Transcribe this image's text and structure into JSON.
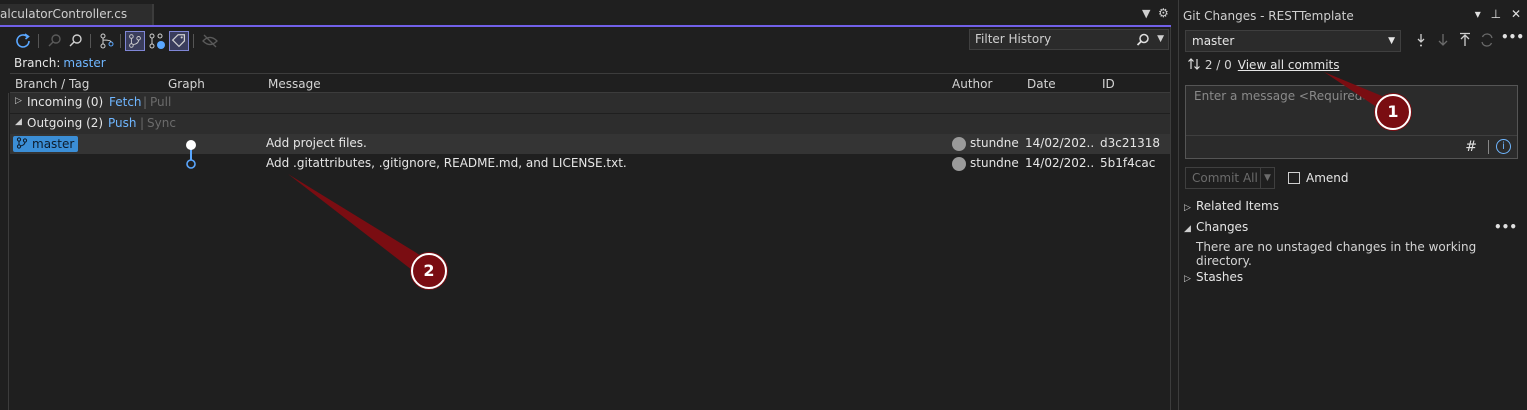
{
  "history": {
    "tab_label": "alculatorController.cs",
    "branch_label": "Branch:",
    "branch_value": "master",
    "filter_placeholder": "Filter History",
    "columns": [
      "Branch / Tag",
      "Graph",
      "Message",
      "Author",
      "Date",
      "ID"
    ],
    "incoming": {
      "label": "Incoming (0)",
      "fetch": "Fetch",
      "pull": "Pull"
    },
    "outgoing": {
      "label": "Outgoing (2)",
      "push": "Push",
      "sync": "Sync"
    },
    "commits": [
      {
        "branch_tag": "master",
        "message": "Add project files.",
        "author": "stundne",
        "date": "14/02/202...",
        "id": "d3c21318"
      },
      {
        "branch_tag": "",
        "message": "Add .gitattributes, .gitignore, README.md, and LICENSE.txt.",
        "author": "stundne",
        "date": "14/02/202...",
        "id": "5b1f4cac"
      }
    ]
  },
  "git_changes": {
    "title": "Git Changes - RESTTemplate",
    "branch": "master",
    "in_out": "2 / 0",
    "view_all": "View all commits",
    "message_placeholder": "Enter a message <Required>",
    "commit_all": "Commit All",
    "amend": "Amend",
    "related_items": "Related Items",
    "changes": "Changes",
    "changes_note": "There are no unstaged changes in the working directory.",
    "stashes": "Stashes"
  },
  "callouts": [
    "1",
    "2"
  ],
  "colors": {
    "accent": "#7160e8",
    "link": "#6fb6ff",
    "callout": "#7a0d12",
    "branch_pill": "#3b8ed6"
  }
}
